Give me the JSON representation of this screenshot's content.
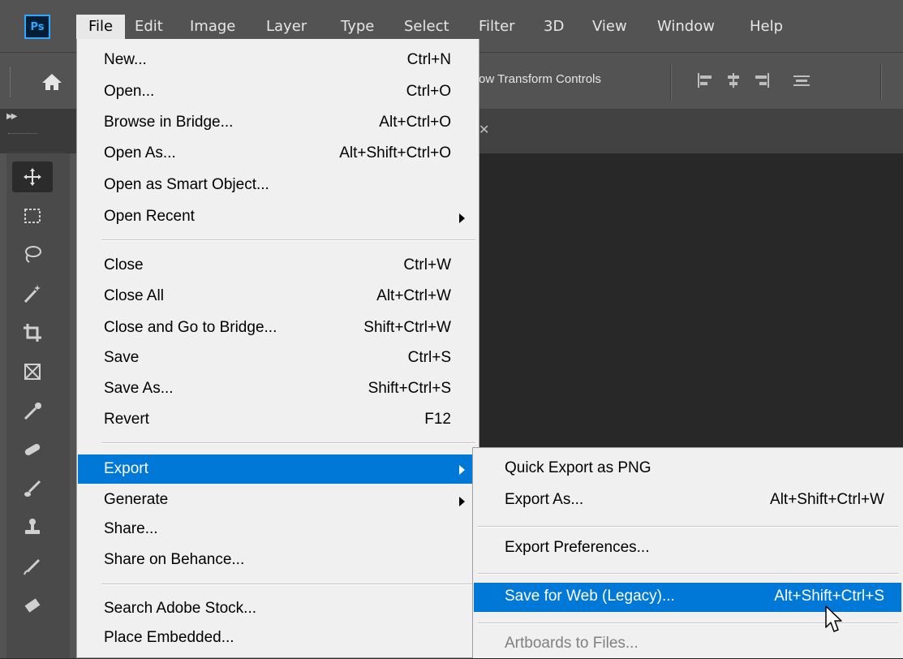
{
  "app": {
    "logo_text": "Ps",
    "brand_color": "#31a8ff"
  },
  "menubar": {
    "items": [
      "File",
      "Edit",
      "Image",
      "Layer",
      "Type",
      "Select",
      "Filter",
      "3D",
      "View",
      "Window",
      "Help"
    ]
  },
  "options_bar": {
    "transform_text": "ow Transform Controls"
  },
  "file_menu": {
    "items": [
      {
        "label": "New...",
        "shortcut": "Ctrl+N"
      },
      {
        "label": "Open...",
        "shortcut": "Ctrl+O"
      },
      {
        "label": "Browse in Bridge...",
        "shortcut": "Alt+Ctrl+O"
      },
      {
        "label": "Open As...",
        "shortcut": "Alt+Shift+Ctrl+O"
      },
      {
        "label": "Open as Smart Object...",
        "shortcut": ""
      },
      {
        "label": "Open Recent",
        "shortcut": ""
      },
      {
        "label": "Close",
        "shortcut": "Ctrl+W"
      },
      {
        "label": "Close All",
        "shortcut": "Alt+Ctrl+W"
      },
      {
        "label": "Close and Go to Bridge...",
        "shortcut": "Shift+Ctrl+W"
      },
      {
        "label": "Save",
        "shortcut": "Ctrl+S"
      },
      {
        "label": "Save As...",
        "shortcut": "Shift+Ctrl+S"
      },
      {
        "label": "Revert",
        "shortcut": "F12"
      },
      {
        "label": "Export",
        "shortcut": ""
      },
      {
        "label": "Generate",
        "shortcut": ""
      },
      {
        "label": "Share...",
        "shortcut": ""
      },
      {
        "label": "Share on Behance...",
        "shortcut": ""
      },
      {
        "label": "Search Adobe Stock...",
        "shortcut": ""
      },
      {
        "label": "Place Embedded...",
        "shortcut": ""
      }
    ],
    "highlighted": "Export",
    "highlight_color": "#0078d7"
  },
  "export_submenu": {
    "items": [
      {
        "label": "Quick Export as PNG",
        "shortcut": ""
      },
      {
        "label": "Export As...",
        "shortcut": "Alt+Shift+Ctrl+W"
      },
      {
        "label": "Export Preferences...",
        "shortcut": ""
      },
      {
        "label": "Save for Web (Legacy)...",
        "shortcut": "Alt+Shift+Ctrl+S"
      },
      {
        "label": "Artboards to Files...",
        "shortcut": ""
      }
    ],
    "highlighted": "Save for Web (Legacy)...",
    "disabled": [
      "Artboards to Files..."
    ]
  },
  "tools": [
    "move-tool",
    "marquee-tool",
    "lasso-tool",
    "magic-wand-tool",
    "crop-tool",
    "frame-tool",
    "eyedropper-tool",
    "healing-brush-tool",
    "brush-tool",
    "clone-stamp-tool",
    "history-brush-tool",
    "eraser-tool"
  ]
}
